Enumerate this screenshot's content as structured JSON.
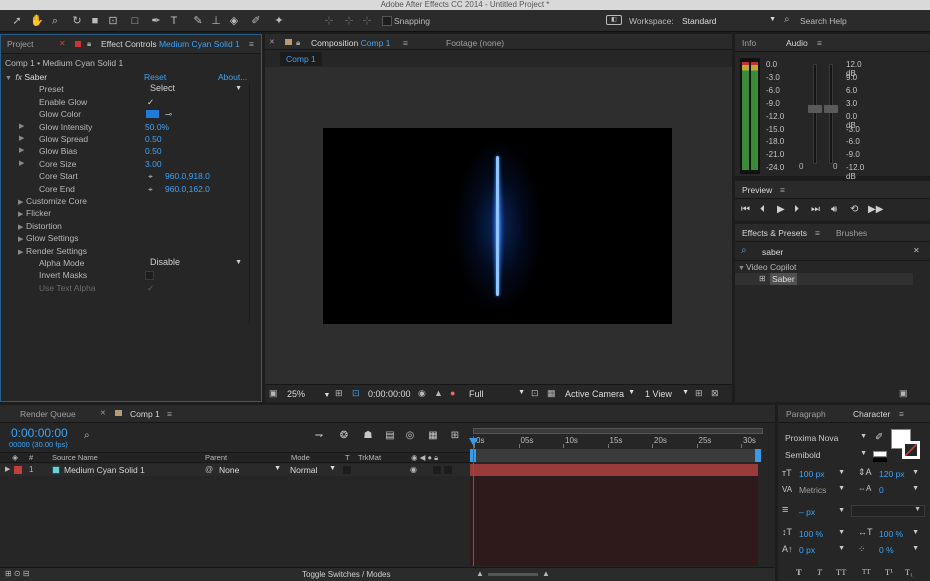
{
  "window": {
    "title": "Adobe After Effects CC 2014 - Untitled Project *"
  },
  "toolbar": {
    "snapping_label": "Snapping",
    "workspace_label": "Workspace:",
    "workspace_value": "Standard",
    "search_help": "Search Help",
    "tools": [
      "selection-tool-icon",
      "hand-tool-icon",
      "zoom-tool-icon",
      "rotate-tool-icon",
      "camera-tool-icon",
      "pan-behind-tool-icon",
      "mask-tool-icon",
      "pen-tool-icon",
      "type-tool-icon",
      "brush-tool-icon",
      "clone-stamp-tool-icon",
      "eraser-tool-icon",
      "roto-brush-tool-icon",
      "puppet-pin-tool-icon"
    ]
  },
  "left_panel": {
    "tabs": {
      "project": "Project",
      "effect_controls": "Effect Controls",
      "layer_name": "Medium Cyan Solid 1"
    },
    "breadcrumb": "Comp 1 • Medium Cyan Solid 1",
    "effect": {
      "fx": "fx",
      "name": "Saber",
      "reset": "Reset",
      "about": "About..."
    },
    "props": {
      "preset": {
        "label": "Preset",
        "value": "Select"
      },
      "enable_glow": {
        "label": "Enable Glow",
        "value": "✓"
      },
      "glow_color": {
        "label": "Glow Color",
        "color": "#1e7bd9"
      },
      "glow_intensity": {
        "label": "Glow Intensity",
        "value": "50.0%"
      },
      "glow_spread": {
        "label": "Glow Spread",
        "value": "0.50"
      },
      "glow_bias": {
        "label": "Glow Bias",
        "value": "0.50"
      },
      "core_size": {
        "label": "Core Size",
        "value": "3.00"
      },
      "core_start": {
        "label": "Core Start",
        "value": "960.0,918.0"
      },
      "core_end": {
        "label": "Core End",
        "value": "960.0,162.0"
      },
      "customize_core": {
        "label": "Customize Core"
      },
      "flicker": {
        "label": "Flicker"
      },
      "distortion": {
        "label": "Distortion"
      },
      "glow_settings": {
        "label": "Glow Settings"
      },
      "render_settings": {
        "label": "Render Settings"
      },
      "alpha_mode": {
        "label": "Alpha Mode",
        "value": "Disable"
      },
      "invert_masks": {
        "label": "Invert Masks"
      },
      "use_text_alpha": {
        "label": "Use Text Alpha",
        "value": "✓"
      }
    }
  },
  "viewer": {
    "tab_composition": "Composition",
    "comp_name": "Comp 1",
    "footage_tab": "Footage (none)",
    "subtab": "Comp 1",
    "saber_color": "#3a8cff",
    "footer": {
      "zoom": "25%",
      "time": "0:00:00:00",
      "resolution": "Full",
      "camera": "Active Camera",
      "views": "1 View"
    }
  },
  "right_panel": {
    "info_tab": "Info",
    "audio_tab": "Audio",
    "audio_left_ticks": [
      "0.0",
      "-3.0",
      "-6.0",
      "-9.0",
      "-12.0",
      "-15.0",
      "-18.0",
      "-21.0",
      "-24.0"
    ],
    "audio_right_ticks": [
      "12.0 dB",
      "9.0",
      "6.0",
      "3.0",
      "0.0 dB",
      "-3.0",
      "-6.0",
      "-9.0",
      "-12.0 dB"
    ],
    "audio_bottom": [
      "0",
      "0"
    ],
    "preview_tab": "Preview",
    "effects_tab": "Effects & Presets",
    "brushes_tab": "Brushes",
    "search_value": "saber",
    "tree_folder": "Video Copilot",
    "tree_item": "Saber"
  },
  "timeline": {
    "render_queue_tab": "Render Queue",
    "comp_tab": "Comp 1",
    "timecode": "0:00:00:00",
    "frames": "00000 (30.00 fps)",
    "columns": {
      "num": "#",
      "source": "Source Name",
      "parent": "Parent",
      "mode": "Mode",
      "t": "T",
      "trkmat": "TrkMat"
    },
    "layer": {
      "num": "1",
      "name": "Medium Cyan Solid 1",
      "parent": "None",
      "mode": "Normal",
      "label_color": "#c33d3d",
      "swatch_color": "#6fcfd6"
    },
    "ruler": [
      "0s",
      "05s",
      "10s",
      "15s",
      "20s",
      "25s",
      "30s"
    ],
    "toggle": "Toggle Switches / Modes"
  },
  "character": {
    "paragraph_tab": "Paragraph",
    "character_tab": "Character",
    "font": "Proxima Nova",
    "style": "Semibold",
    "size": "100 px",
    "leading": "120 px",
    "kerning": "Metrics",
    "tracking": "0",
    "stroke": "– px",
    "vscale": "100 %",
    "hscale": "100 %",
    "baseline": "0 px",
    "tsume": "0 %",
    "styles": [
      "T",
      "T",
      "TT",
      "TT",
      "T¹",
      "T₁"
    ]
  }
}
